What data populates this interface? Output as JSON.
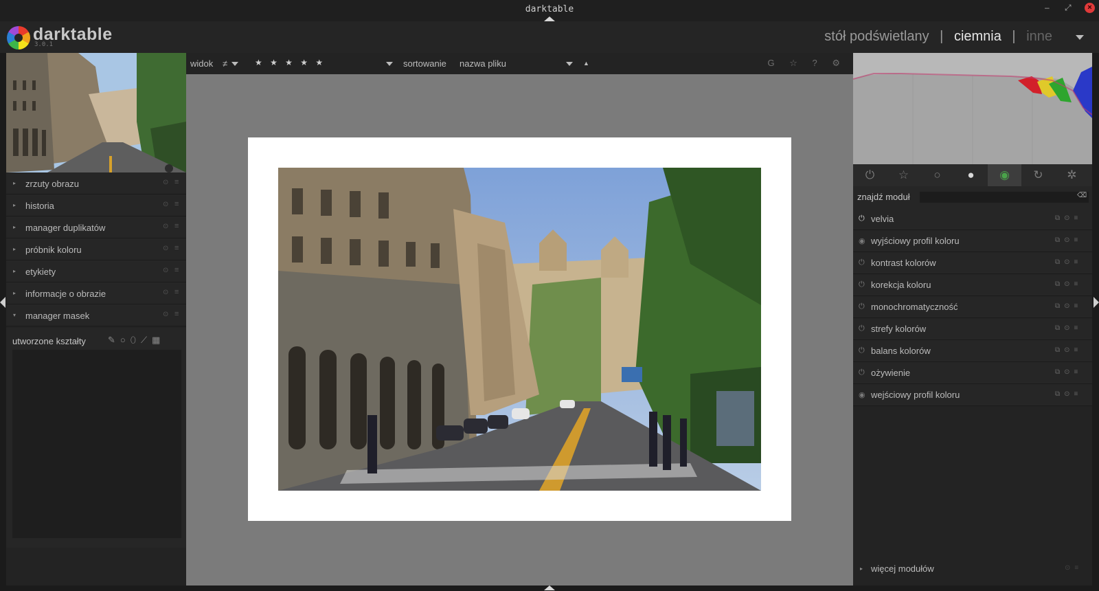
{
  "window": {
    "title": "darktable"
  },
  "app": {
    "name": "darktable",
    "version": "3.0.1"
  },
  "views": {
    "lighttable": "stół podświetlany",
    "darkroom": "ciemnia",
    "other": "inne",
    "sep": "|"
  },
  "left_modules": [
    {
      "label": "zrzuty obrazu",
      "expanded": false
    },
    {
      "label": "historia",
      "expanded": false
    },
    {
      "label": "manager duplikatów",
      "expanded": false
    },
    {
      "label": "próbnik koloru",
      "expanded": false
    },
    {
      "label": "etykiety",
      "expanded": false
    },
    {
      "label": "informacje o obrazie",
      "expanded": false
    },
    {
      "label": "manager masek",
      "expanded": true
    }
  ],
  "masks": {
    "title": "utworzone kształty"
  },
  "filmstrip_bar": {
    "view_label": "widok",
    "comparator": "≠",
    "stars": "★ ★ ★ ★ ★",
    "sort_label": "sortowanie",
    "sort_value": "nazwa pliku",
    "sort_dir": "▲",
    "right_icons": "G ☆ ? ⚙"
  },
  "right_tabs": [
    {
      "icon": "power-icon",
      "glyph": "⏻"
    },
    {
      "icon": "star-icon",
      "glyph": "☆"
    },
    {
      "icon": "circle-icon",
      "glyph": "○"
    },
    {
      "icon": "tone-icon",
      "glyph": "●"
    },
    {
      "icon": "color-icon",
      "glyph": "◉",
      "active": true
    },
    {
      "icon": "correct-icon",
      "glyph": "↻"
    },
    {
      "icon": "effect-icon",
      "glyph": "✲"
    }
  ],
  "module_search": {
    "label": "znajdź moduł",
    "value": ""
  },
  "right_modules": [
    {
      "label": "velvia",
      "on": true
    },
    {
      "label": "wyjściowy profil koloru",
      "on": true
    },
    {
      "label": "kontrast kolorów",
      "on": false
    },
    {
      "label": "korekcja koloru",
      "on": false
    },
    {
      "label": "monochromatyczność",
      "on": false
    },
    {
      "label": "strefy kolorów",
      "on": false
    },
    {
      "label": "balans kolorów",
      "on": false
    },
    {
      "label": "ożywienie",
      "on": false
    },
    {
      "label": "wejściowy profil koloru",
      "on": true
    }
  ],
  "more_modules": {
    "label": "więcej modułów"
  },
  "colors": {
    "accent_active_view": "#e6e6e6",
    "close_button": "#e03a3a"
  }
}
